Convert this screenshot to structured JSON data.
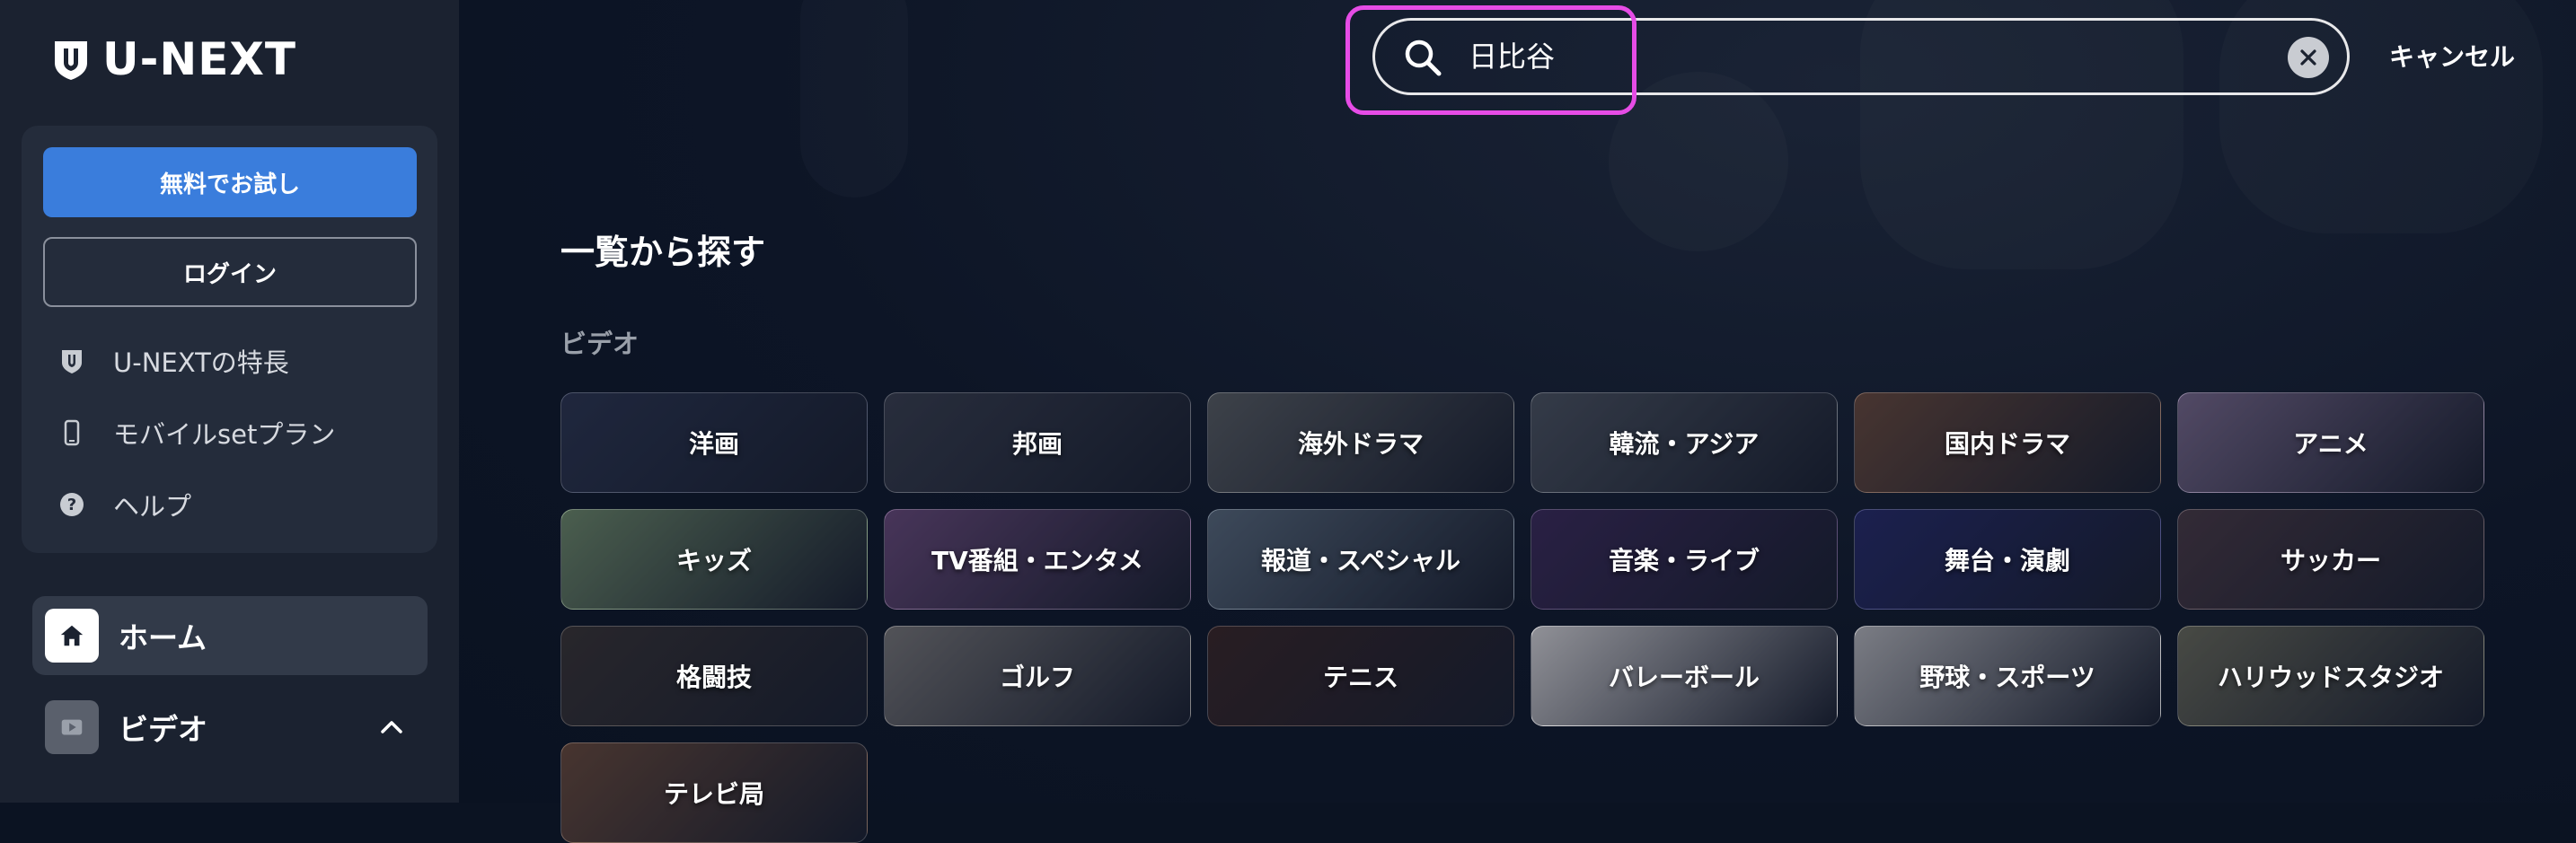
{
  "brand": {
    "logo_text": "U-NEXT"
  },
  "sidebar": {
    "trial_button": "無料でお試し",
    "login_button": "ログイン",
    "links": [
      {
        "label": "U-NEXTの特長",
        "icon": "shield-icon"
      },
      {
        "label": "モバイルsetプラン",
        "icon": "phone-icon"
      },
      {
        "label": "ヘルプ",
        "icon": "help-icon"
      }
    ],
    "nav": {
      "home": "ホーム",
      "video": "ビデオ"
    }
  },
  "search": {
    "value": "日比谷",
    "cancel_label": "キャンセル"
  },
  "main": {
    "section_title": "一覧から探す",
    "section_sub": "ビデオ",
    "categories": [
      {
        "label": "洋画",
        "color": "#2c3550"
      },
      {
        "label": "邦画",
        "color": "#3a3f4e"
      },
      {
        "label": "海外ドラマ",
        "color": "#5a5e62"
      },
      {
        "label": "韓流・アジア",
        "color": "#4d5460"
      },
      {
        "label": "国内ドラマ",
        "color": "#6a4a3c"
      },
      {
        "label": "アニメ",
        "color": "#7a6a8c"
      },
      {
        "label": "キッズ",
        "color": "#6f8a6a"
      },
      {
        "label": "TV番組・エンタメ",
        "color": "#6a4a7a"
      },
      {
        "label": "報道・スペシャル",
        "color": "#5a6a7c"
      },
      {
        "label": "音楽・ライブ",
        "color": "#3c2a5a"
      },
      {
        "label": "舞台・演劇",
        "color": "#262a6a"
      },
      {
        "label": "サッカー",
        "color": "#4a3a44"
      },
      {
        "label": "格闘技",
        "color": "#3a3434"
      },
      {
        "label": "ゴルフ",
        "color": "#7a7878"
      },
      {
        "label": "テニス",
        "color": "#3a2626"
      },
      {
        "label": "バレーボール",
        "color": "#d8d6d8"
      },
      {
        "label": "野球・スポーツ",
        "color": "#b8b8bc"
      },
      {
        "label": "ハリウッドスタジオ",
        "color": "#6a6a5a"
      },
      {
        "label": "テレビ局",
        "color": "#6a4a3a"
      }
    ]
  }
}
